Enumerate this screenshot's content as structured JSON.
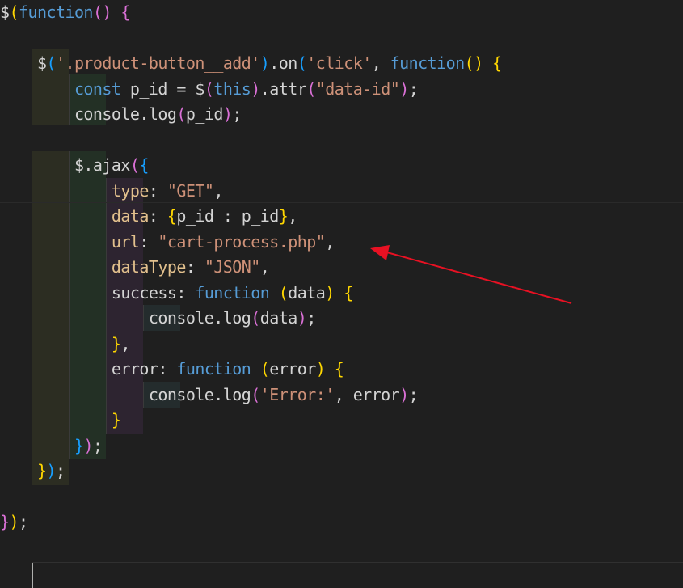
{
  "editor": {
    "language": "javascript",
    "colors": {
      "background": "#1f1f1f",
      "text": "#d4d4d4",
      "keyword": "#569cd6",
      "string": "#ce9178",
      "property": "#e2c08d",
      "bracket_gold": "#ffd700",
      "bracket_pink": "#da70d6",
      "bracket_blue": "#179fff",
      "arrow": "#e81123"
    },
    "lines": [
      [
        {
          "t": "$",
          "c": "text"
        },
        {
          "t": "(",
          "c": "bracket_gold"
        },
        {
          "t": "function",
          "c": "keyword"
        },
        {
          "t": "()",
          "c": "bracket_pink"
        },
        {
          "t": " ",
          "c": "text"
        },
        {
          "t": "{",
          "c": "bracket_pink"
        }
      ],
      [],
      [
        {
          "t": "    ",
          "c": "text"
        },
        {
          "t": "$",
          "c": "text"
        },
        {
          "t": "(",
          "c": "bracket_blue"
        },
        {
          "t": "'.product-button__add'",
          "c": "string"
        },
        {
          "t": ")",
          "c": "bracket_blue"
        },
        {
          "t": ".on",
          "c": "text"
        },
        {
          "t": "(",
          "c": "bracket_blue"
        },
        {
          "t": "'click'",
          "c": "string"
        },
        {
          "t": ", ",
          "c": "text"
        },
        {
          "t": "function",
          "c": "keyword"
        },
        {
          "t": "()",
          "c": "bracket_gold"
        },
        {
          "t": " ",
          "c": "text"
        },
        {
          "t": "{",
          "c": "bracket_gold"
        }
      ],
      [
        {
          "t": "        ",
          "c": "text"
        },
        {
          "t": "const",
          "c": "keyword"
        },
        {
          "t": " p_id = $",
          "c": "text"
        },
        {
          "t": "(",
          "c": "bracket_pink"
        },
        {
          "t": "this",
          "c": "keyword"
        },
        {
          "t": ")",
          "c": "bracket_pink"
        },
        {
          "t": ".attr",
          "c": "text"
        },
        {
          "t": "(",
          "c": "bracket_pink"
        },
        {
          "t": "\"data-id\"",
          "c": "string"
        },
        {
          "t": ")",
          "c": "bracket_pink"
        },
        {
          "t": ";",
          "c": "text"
        }
      ],
      [
        {
          "t": "        ",
          "c": "text"
        },
        {
          "t": "console.log",
          "c": "text"
        },
        {
          "t": "(",
          "c": "bracket_pink"
        },
        {
          "t": "p_id",
          "c": "text"
        },
        {
          "t": ")",
          "c": "bracket_pink"
        },
        {
          "t": ";",
          "c": "text"
        }
      ],
      [],
      [
        {
          "t": "        ",
          "c": "text"
        },
        {
          "t": "$.ajax",
          "c": "text"
        },
        {
          "t": "(",
          "c": "bracket_pink"
        },
        {
          "t": "{",
          "c": "bracket_blue"
        }
      ],
      [
        {
          "t": "            ",
          "c": "text"
        },
        {
          "t": "type",
          "c": "property"
        },
        {
          "t": ": ",
          "c": "text"
        },
        {
          "t": "\"GET\"",
          "c": "string"
        },
        {
          "t": ",",
          "c": "text"
        }
      ],
      [
        {
          "t": "            ",
          "c": "text"
        },
        {
          "t": "data",
          "c": "property"
        },
        {
          "t": ": ",
          "c": "text"
        },
        {
          "t": "{",
          "c": "bracket_gold"
        },
        {
          "t": "p_id : p_id",
          "c": "text"
        },
        {
          "t": "}",
          "c": "bracket_gold"
        },
        {
          "t": ",",
          "c": "text"
        }
      ],
      [
        {
          "t": "            ",
          "c": "text"
        },
        {
          "t": "url",
          "c": "property"
        },
        {
          "t": ": ",
          "c": "text"
        },
        {
          "t": "\"cart-process.php\"",
          "c": "string"
        },
        {
          "t": ",",
          "c": "text"
        }
      ],
      [
        {
          "t": "            ",
          "c": "text"
        },
        {
          "t": "dataType",
          "c": "property"
        },
        {
          "t": ": ",
          "c": "text"
        },
        {
          "t": "\"JSON\"",
          "c": "string"
        },
        {
          "t": ",",
          "c": "text"
        }
      ],
      [
        {
          "t": "            ",
          "c": "text"
        },
        {
          "t": "success",
          "c": "text"
        },
        {
          "t": ": ",
          "c": "text"
        },
        {
          "t": "function",
          "c": "keyword"
        },
        {
          "t": " ",
          "c": "text"
        },
        {
          "t": "(",
          "c": "bracket_gold"
        },
        {
          "t": "data",
          "c": "text"
        },
        {
          "t": ")",
          "c": "bracket_gold"
        },
        {
          "t": " ",
          "c": "text"
        },
        {
          "t": "{",
          "c": "bracket_gold"
        }
      ],
      [
        {
          "t": "                ",
          "c": "text"
        },
        {
          "t": "console.log",
          "c": "text"
        },
        {
          "t": "(",
          "c": "bracket_pink"
        },
        {
          "t": "data",
          "c": "text"
        },
        {
          "t": ")",
          "c": "bracket_pink"
        },
        {
          "t": ";",
          "c": "text"
        }
      ],
      [
        {
          "t": "            ",
          "c": "text"
        },
        {
          "t": "}",
          "c": "bracket_gold"
        },
        {
          "t": ",",
          "c": "text"
        }
      ],
      [
        {
          "t": "            ",
          "c": "text"
        },
        {
          "t": "error",
          "c": "text"
        },
        {
          "t": ": ",
          "c": "text"
        },
        {
          "t": "function",
          "c": "keyword"
        },
        {
          "t": " ",
          "c": "text"
        },
        {
          "t": "(",
          "c": "bracket_gold"
        },
        {
          "t": "error",
          "c": "text"
        },
        {
          "t": ")",
          "c": "bracket_gold"
        },
        {
          "t": " ",
          "c": "text"
        },
        {
          "t": "{",
          "c": "bracket_gold"
        }
      ],
      [
        {
          "t": "                ",
          "c": "text"
        },
        {
          "t": "console.log",
          "c": "text"
        },
        {
          "t": "(",
          "c": "bracket_pink"
        },
        {
          "t": "'Error:'",
          "c": "string"
        },
        {
          "t": ", ",
          "c": "text"
        },
        {
          "t": "error",
          "c": "text"
        },
        {
          "t": ")",
          "c": "bracket_pink"
        },
        {
          "t": ";",
          "c": "text"
        }
      ],
      [
        {
          "t": "            ",
          "c": "text"
        },
        {
          "t": "}",
          "c": "bracket_gold"
        }
      ],
      [
        {
          "t": "        ",
          "c": "text"
        },
        {
          "t": "}",
          "c": "bracket_blue"
        },
        {
          "t": ")",
          "c": "bracket_pink"
        },
        {
          "t": ";",
          "c": "text"
        }
      ],
      [
        {
          "t": "    ",
          "c": "text"
        },
        {
          "t": "}",
          "c": "bracket_gold"
        },
        {
          "t": ")",
          "c": "bracket_blue"
        },
        {
          "t": ";",
          "c": "text"
        }
      ],
      [],
      [
        {
          "t": "}",
          "c": "bracket_pink"
        },
        {
          "t": ")",
          "c": "bracket_gold"
        },
        {
          "t": ";",
          "c": "text"
        }
      ],
      [],
      []
    ]
  },
  "annotation": {
    "type": "arrow",
    "points_to": "cart-process.php"
  }
}
